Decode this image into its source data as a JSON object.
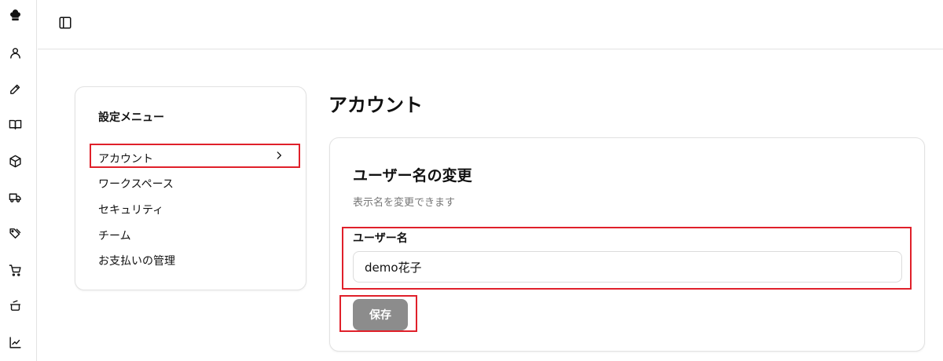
{
  "sidebar_icons": [
    "chef-hat-icon",
    "user-icon",
    "pen-tool-icon",
    "book-icon",
    "package-icon",
    "truck-icon",
    "tags-icon",
    "cart-icon",
    "cooking-pot-icon",
    "chart-icon"
  ],
  "topbar": {
    "toggle_icon": "sidebar-toggle-icon"
  },
  "settings_menu": {
    "title": "設定メニュー",
    "items": [
      {
        "label": "アカウント",
        "active": true
      },
      {
        "label": "ワークスペース"
      },
      {
        "label": "セキュリティ"
      },
      {
        "label": "チーム"
      },
      {
        "label": "お支払いの管理"
      }
    ]
  },
  "page": {
    "title": "アカウント"
  },
  "username_card": {
    "title": "ユーザー名の変更",
    "description": "表示名を変更できます",
    "field_label": "ユーザー名",
    "field_value": "demo花子",
    "save_label": "保存"
  },
  "colors": {
    "highlight": "#e0202a",
    "button_disabled": "#8c8c8c",
    "muted_text": "#777777",
    "border": "#e2e2e2"
  }
}
